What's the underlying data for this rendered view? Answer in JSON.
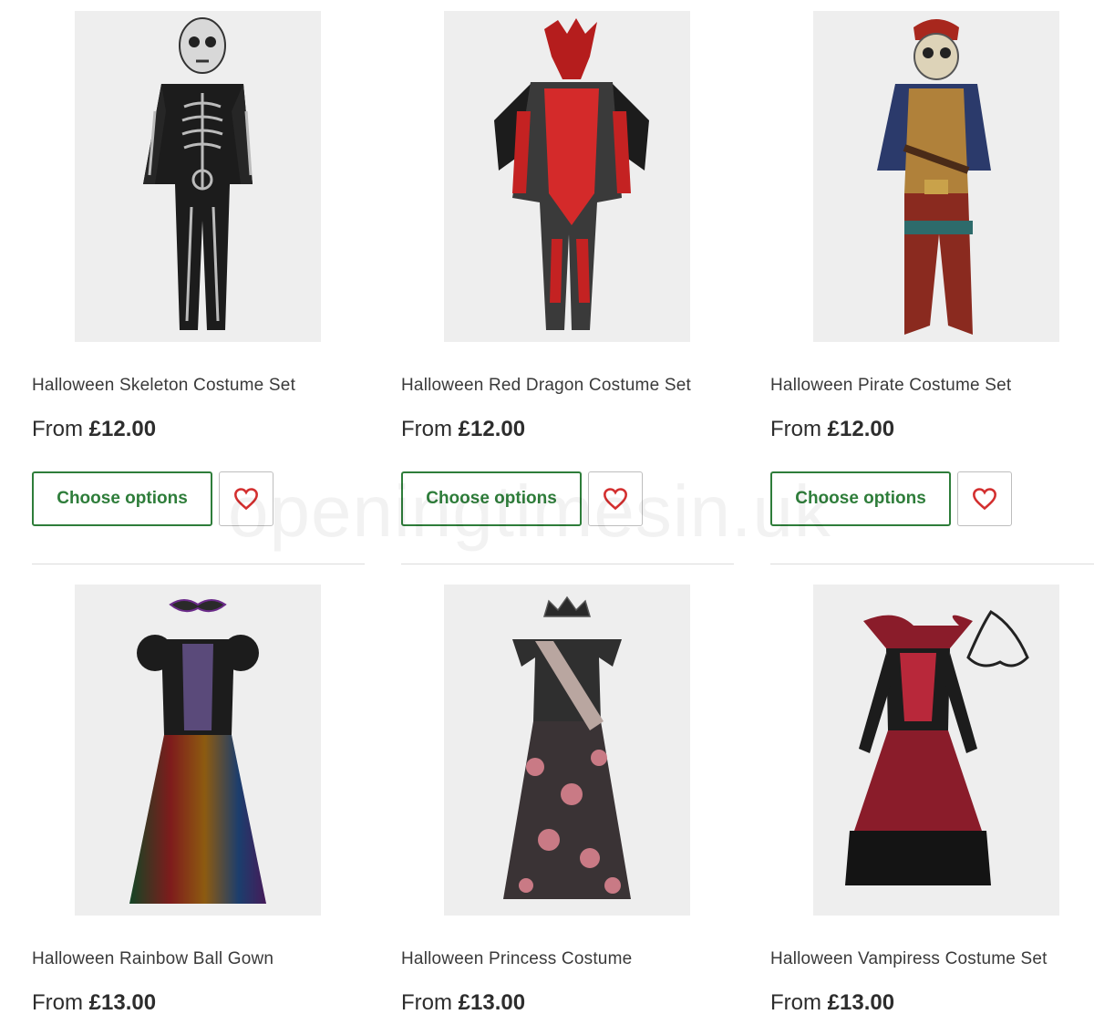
{
  "products": [
    {
      "title": "Halloween Skeleton Costume Set",
      "from": "From",
      "price": "£12.00",
      "button": "Choose options",
      "icon": "skeleton-costume"
    },
    {
      "title": "Halloween Red Dragon Costume Set",
      "from": "From",
      "price": "£12.00",
      "button": "Choose options",
      "icon": "dragon-costume"
    },
    {
      "title": "Halloween Pirate Costume Set",
      "from": "From",
      "price": "£12.00",
      "button": "Choose options",
      "icon": "pirate-costume"
    },
    {
      "title": "Halloween Rainbow Ball Gown",
      "from": "From",
      "price": "£13.00",
      "icon": "rainbow-gown"
    },
    {
      "title": "Halloween Princess Costume",
      "from": "From",
      "price": "£13.00",
      "icon": "princess-costume"
    },
    {
      "title": "Halloween Vampiress Costume Set",
      "from": "From",
      "price": "£13.00",
      "icon": "vampiress-costume"
    }
  ],
  "watermark": "openingtimesin.uk",
  "colors": {
    "accent": "#2e7d3a",
    "heart": "#d32f2f",
    "image_bg": "#eeeeee"
  }
}
